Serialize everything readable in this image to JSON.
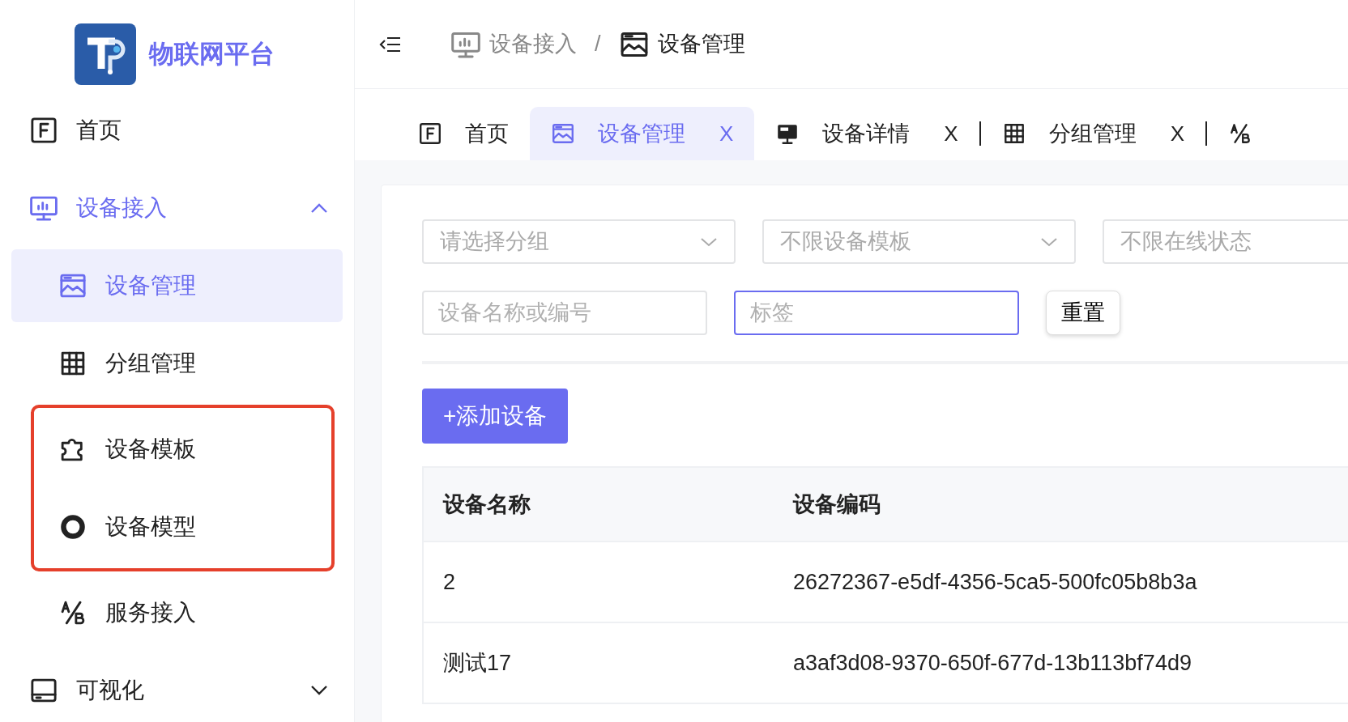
{
  "brand": {
    "title": "物联网平台"
  },
  "sidebar": {
    "items": [
      {
        "label": "首页",
        "selected": false
      },
      {
        "label": "设备接入",
        "selected": false,
        "expanded": true,
        "children": [
          {
            "label": "设备管理",
            "selected": true,
            "highlighted": false
          },
          {
            "label": "分组管理",
            "selected": false,
            "highlighted": false
          },
          {
            "label": "设备模板",
            "selected": false,
            "highlighted": true
          },
          {
            "label": "设备模型",
            "selected": false,
            "highlighted": true
          },
          {
            "label": "服务接入",
            "selected": false,
            "highlighted": false
          }
        ]
      },
      {
        "label": "可视化",
        "selected": false,
        "expanded": false
      }
    ]
  },
  "breadcrumb_separator": "/",
  "breadcrumb": [
    {
      "label": "设备接入",
      "current": false
    },
    {
      "label": "设备管理",
      "current": true
    }
  ],
  "tabs": [
    {
      "label": "首页",
      "selected": false
    },
    {
      "label": "设备管理",
      "selected": true,
      "close": "X"
    },
    {
      "label": "设备详情",
      "selected": false,
      "close": "X"
    },
    {
      "label": "分组管理",
      "selected": false,
      "close": "X"
    },
    {
      "selected": false
    }
  ],
  "filters": {
    "selects": [
      {
        "placeholder": "请选择分组",
        "dropdown_arrow": true
      },
      {
        "placeholder": "不限设备模板",
        "dropdown_arrow": true
      },
      {
        "placeholder": "不限在线状态"
      }
    ],
    "inputs": [
      {
        "placeholder": "设备名称或编号",
        "focused": false
      },
      {
        "placeholder": "标签",
        "focused": true
      }
    ],
    "reset_button": "重置"
  },
  "add_button": "+添加设备",
  "table": {
    "columns": [
      "设备名称",
      "设备编码"
    ],
    "rows": [
      [
        "2",
        "26272367-e5df-4356-5ca5-500fc05b8b3a"
      ],
      [
        "测试17",
        "a3af3d08-9370-650f-677d-13b113bf74d9"
      ]
    ]
  }
}
